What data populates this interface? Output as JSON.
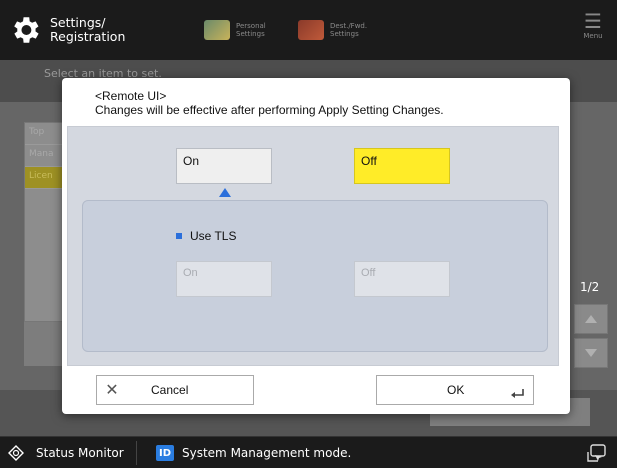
{
  "topbar": {
    "home_title": "Settings/\nRegistration",
    "tabs": [
      {
        "label": "Personal\nSettings"
      },
      {
        "label": "Dest./Fwd.\nSettings"
      }
    ],
    "menu_label": "Menu"
  },
  "background": {
    "hint": "Select an item to set.",
    "list_items": [
      "Top",
      "Mana",
      "Licen"
    ],
    "page_indicator": "1/2"
  },
  "dialog": {
    "title": "<Remote UI>",
    "message": "Changes will be effective after performing Apply Setting Changes.",
    "on_label": "On",
    "off_label": "Off",
    "selected": "Off",
    "tls": {
      "label": "Use TLS",
      "on_label": "On",
      "off_label": "Off",
      "enabled": false
    },
    "cancel_label": "Cancel",
    "ok_label": "OK"
  },
  "statusbar": {
    "status_monitor": "Status Monitor",
    "id_badge": "ID",
    "mode": "System Management mode."
  },
  "colors": {
    "selected_button": "#ffec28",
    "accent_blue": "#2b6fdb",
    "topbar": "#1b1b1b"
  }
}
